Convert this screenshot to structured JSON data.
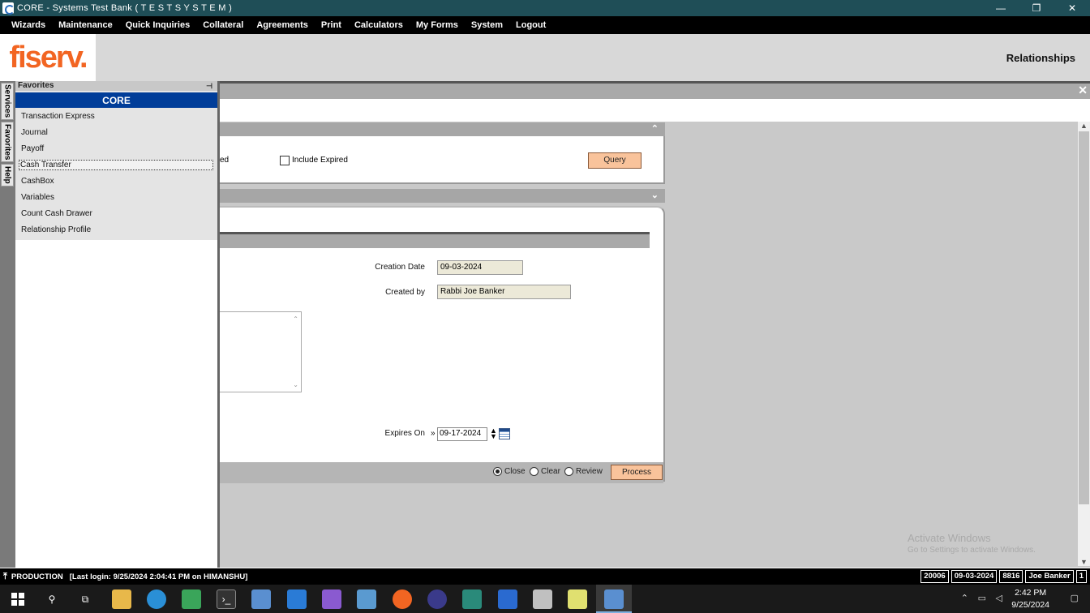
{
  "window": {
    "title": "CORE - Systems Test Bank ( T E S T   S Y S T E M )",
    "min": "—",
    "max": "❐",
    "close": "✕"
  },
  "menu": [
    "Wizards",
    "Maintenance",
    "Quick Inquiries",
    "Collateral",
    "Agreements",
    "Print",
    "Calculators",
    "My Forms",
    "System",
    "Logout"
  ],
  "header": {
    "logo": "fiserv.",
    "page_title": "Relationships"
  },
  "side_tabs": [
    "Services",
    "Favorites",
    "Help"
  ],
  "favorites": {
    "header": "Favorites",
    "group": "CORE",
    "items": [
      "Transaction Express",
      "Journal",
      "Payoff",
      "Cash Transfer",
      "CashBox",
      "Variables",
      "Count Cash Drawer",
      "Relationship Profile"
    ],
    "selected": "Cash Transfer"
  },
  "query_section": {
    "partial_label": "ed",
    "include_expired_label": "Include Expired",
    "include_expired_checked": false,
    "query_button": "Query"
  },
  "detail": {
    "creation_date_label": "Creation Date",
    "creation_date": "09-03-2024",
    "created_by_label": "Created by",
    "created_by": "Rabbi Joe Banker",
    "expires_on_label": "Expires On",
    "expires_on": "09-17-2024"
  },
  "footer_actions": {
    "close": "Close",
    "clear": "Clear",
    "review": "Review",
    "selected": "Close",
    "process": "Process"
  },
  "watermark": {
    "line1": "Activate Windows",
    "line2": "Go to Settings to activate Windows."
  },
  "status": {
    "env": "PRODUCTION",
    "last_login": "[Last login: 9/25/2024 2:04:41 PM on HIMANSHU]",
    "cells": [
      "20006",
      "09-03-2024",
      "8816",
      "Joe Banker",
      "1"
    ]
  },
  "taskbar": {
    "time": "2:42 PM",
    "date": "9/25/2024"
  }
}
